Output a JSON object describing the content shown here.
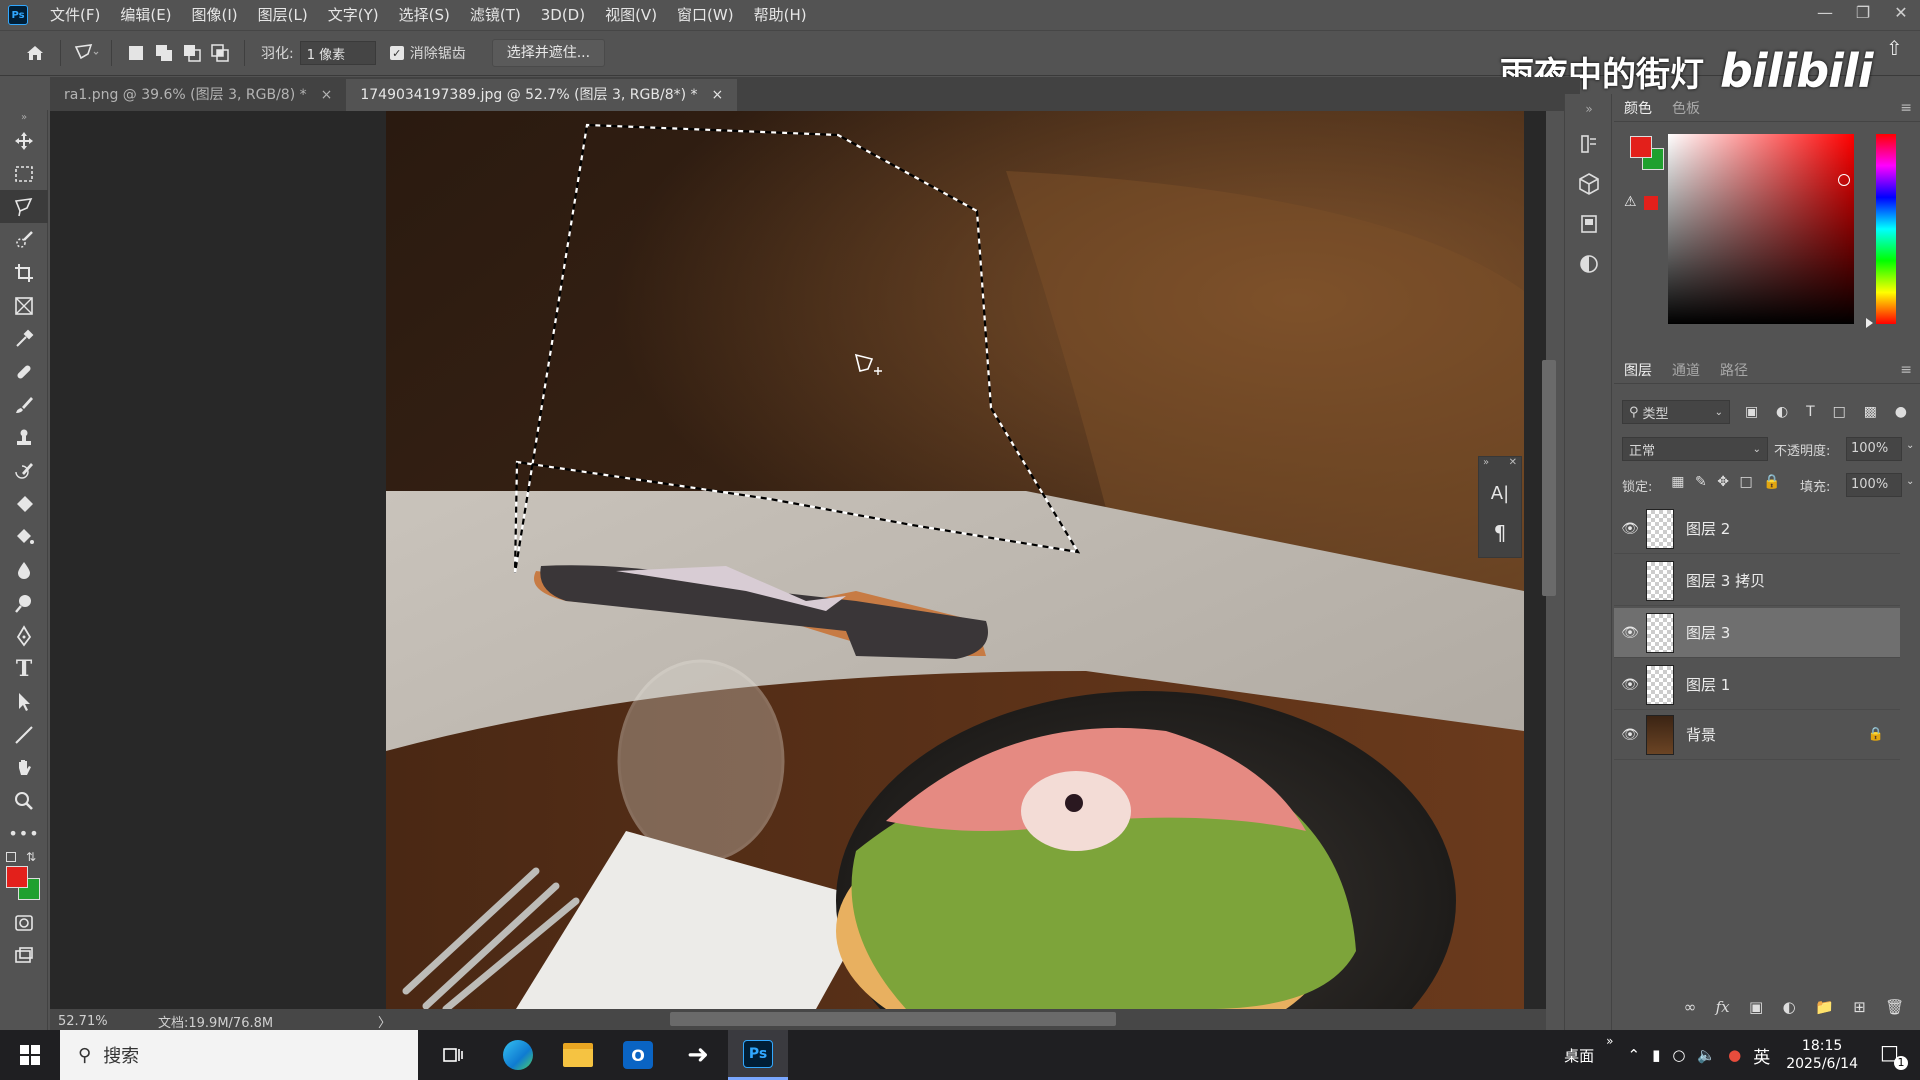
{
  "menubar": {
    "logo": "Ps",
    "items": [
      "文件(F)",
      "编辑(E)",
      "图像(I)",
      "图层(L)",
      "文字(Y)",
      "选择(S)",
      "滤镜(T)",
      "3D(D)",
      "视图(V)",
      "窗口(W)",
      "帮助(H)"
    ]
  },
  "options": {
    "feather_label": "羽化:",
    "feather_value": "1 像素",
    "antialias_label": "消除锯齿",
    "select_mask_button": "选择并遮住..."
  },
  "tabs": [
    {
      "label": "ra1.png @ 39.6% (图层 3, RGB/8) *",
      "close": "×"
    },
    {
      "label": "1749034197389.jpg @ 52.7% (图层 3, RGB/8*) *",
      "close": "×"
    }
  ],
  "status": {
    "zoom": "52.71%",
    "doc": "文档:19.9M/76.8M",
    "arrow": "〉"
  },
  "color_panel": {
    "tabs": [
      "颜色",
      "色板"
    ],
    "foreground": "#e3201b",
    "background": "#1fa02e"
  },
  "layers_panel": {
    "tabs": [
      "图层",
      "通道",
      "路径"
    ],
    "filter_label": "类型",
    "blend_mode": "正常",
    "opacity_label": "不透明度:",
    "opacity_value": "100%",
    "lock_label": "锁定:",
    "fill_label": "填充:",
    "fill_value": "100%",
    "layers": [
      {
        "name": "图层 2",
        "visible": true
      },
      {
        "name": "图层 3 拷贝",
        "visible": false
      },
      {
        "name": "图层 3",
        "visible": true,
        "selected": true
      },
      {
        "name": "图层 1",
        "visible": true
      },
      {
        "name": "背景",
        "visible": true,
        "locked": true
      }
    ]
  },
  "watermark": {
    "text": "雨夜中的街灯",
    "logo": "bilibili"
  },
  "taskbar": {
    "search_placeholder": "搜索",
    "desktop_label": "桌面",
    "ime": "英",
    "time": "18:15",
    "date": "2025/6/14",
    "notification_count": "1",
    "ps_label": "Ps"
  },
  "mini_panel": {
    "char_icon": "A|",
    "para_icon": "¶"
  }
}
